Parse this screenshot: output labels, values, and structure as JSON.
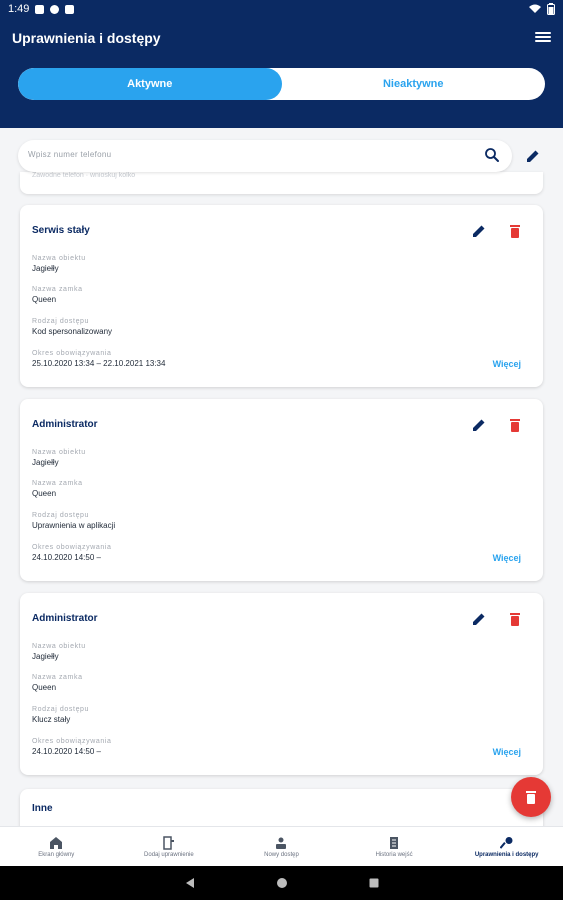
{
  "status_bar": {
    "time": "1:49"
  },
  "header": {
    "title": "Uprawnienia i dostępy"
  },
  "tabs": [
    {
      "label": "Aktywne",
      "active": true
    },
    {
      "label": "Nieaktywne",
      "active": false
    }
  ],
  "search": {
    "placeholder": "Wpisz numer telefonu"
  },
  "partial_card": {
    "ghost_text": "Zawodne telefon · wnioskuj kolko"
  },
  "cards": [
    {
      "title": "Serwis stały",
      "fields": [
        {
          "label": "Nazwa obiektu",
          "value": "Jagiełły"
        },
        {
          "label": "Nazwa zamka",
          "value": "Queen"
        },
        {
          "label": "Rodzaj dostępu",
          "value": "Kod spersonalizowany"
        },
        {
          "label": "Okres obowiązywania",
          "value": "25.10.2020 13:34 – 22.10.2021 13:34"
        }
      ],
      "more": "Więcej"
    },
    {
      "title": "Administrator",
      "fields": [
        {
          "label": "Nazwa obiektu",
          "value": "Jagiełły"
        },
        {
          "label": "Nazwa zamka",
          "value": "Queen"
        },
        {
          "label": "Rodzaj dostępu",
          "value": "Uprawnienia w aplikacji"
        },
        {
          "label": "Okres obowiązywania",
          "value": "24.10.2020 14:50 –"
        }
      ],
      "more": "Więcej"
    },
    {
      "title": "Administrator",
      "fields": [
        {
          "label": "Nazwa obiektu",
          "value": "Jagiełły"
        },
        {
          "label": "Nazwa zamka",
          "value": "Queen"
        },
        {
          "label": "Rodzaj dostępu",
          "value": "Klucz stały"
        },
        {
          "label": "Okres obowiązywania",
          "value": "24.10.2020 14:50 –"
        }
      ],
      "more": "Więcej"
    }
  ],
  "last_card": {
    "title": "Inne"
  },
  "bottom_nav": [
    {
      "label": "Ekran główny",
      "icon": "home-icon",
      "active": false
    },
    {
      "label": "Dodaj uprawnienie",
      "icon": "door-icon",
      "active": false
    },
    {
      "label": "Nowy dostęp",
      "icon": "person-badge-icon",
      "active": false
    },
    {
      "label": "Historia wejść",
      "icon": "document-icon",
      "active": false
    },
    {
      "label": "Uprawnienia i dostępy",
      "icon": "key-icon",
      "active": true
    }
  ],
  "colors": {
    "primary": "#0b2a63",
    "accent": "#2aa3ee",
    "danger": "#e53935"
  }
}
